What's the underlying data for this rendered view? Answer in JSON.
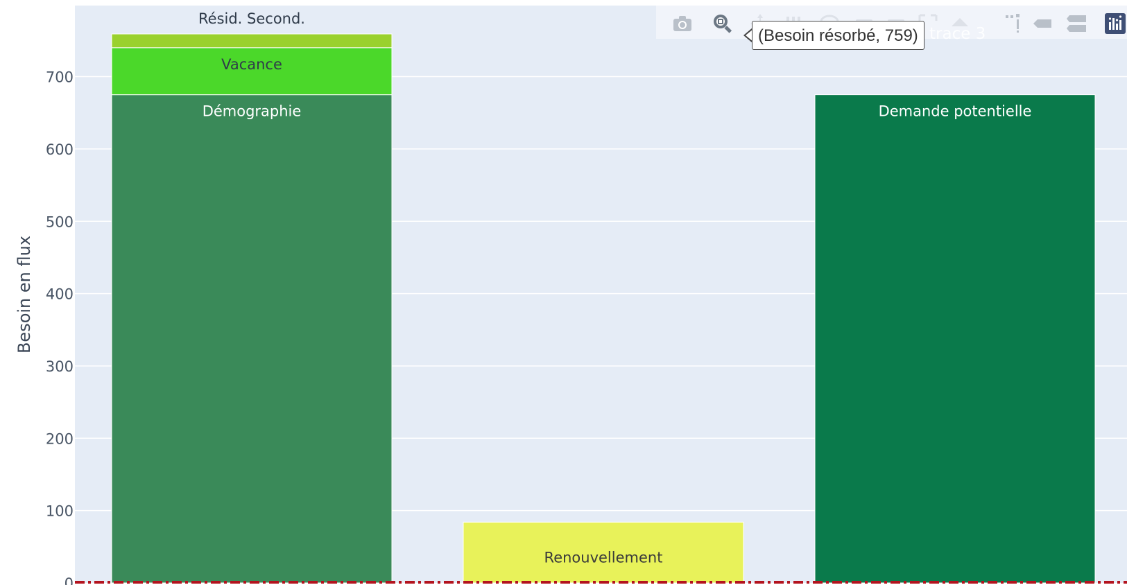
{
  "chart_data": {
    "type": "bar",
    "barmode": "stack",
    "categories": [
      "",
      "",
      ""
    ],
    "series": [
      {
        "values": [
          675,
          0,
          675
        ],
        "bar_colors": [
          "#3a8a59",
          "#ffffff",
          "#0a7a4b"
        ],
        "labels": [
          "Démographie",
          "",
          "Demande potentielle"
        ],
        "label_colors": [
          "#ffffff",
          "#333333",
          "#ffffff"
        ]
      },
      {
        "values": [
          65,
          84,
          0
        ],
        "bar_colors": [
          "#4bd82a",
          "#e8f25a",
          "#0a7a4b"
        ],
        "labels": [
          "Vacance",
          "Renouvellement",
          ""
        ],
        "label_colors": [
          "#2f3b4a",
          "#3a3a3a",
          "#ffffff"
        ]
      },
      {
        "values": [
          19,
          0,
          0
        ],
        "bar_colors": [
          "#9ad12d",
          "#ffffff",
          "#ffffff"
        ],
        "labels": [
          "Résid. Second.",
          "",
          ""
        ],
        "label_colors": [
          "#2f3b4a",
          "#333333",
          "#333333"
        ]
      }
    ],
    "ylabel": "Besoin en flux",
    "xlabel": "",
    "ylim": [
      0,
      795
    ],
    "yticks": [
      0,
      100,
      200,
      300,
      400,
      500,
      600,
      700
    ],
    "grid": true,
    "reference_line": {
      "y": 0,
      "style": "dash-dot",
      "color": "#b3141f"
    },
    "plot_bg": "#e5ecf6",
    "grid_color": "#ffffff"
  },
  "tooltip": {
    "text": "(Besoin résorbé, 759)"
  },
  "legend_ghost": {
    "text": "trace 3"
  },
  "modebar": {
    "icons": [
      "camera-icon",
      "zoom-icon",
      "pan-icon",
      "box-select-icon",
      "lasso-icon",
      "zoom-in-icon",
      "zoom-out-icon",
      "autoscale-icon",
      "reset-axes-icon",
      "spike-lines-icon",
      "hover-closest-icon",
      "hover-compare-icon",
      "plotly-logo-icon"
    ]
  }
}
